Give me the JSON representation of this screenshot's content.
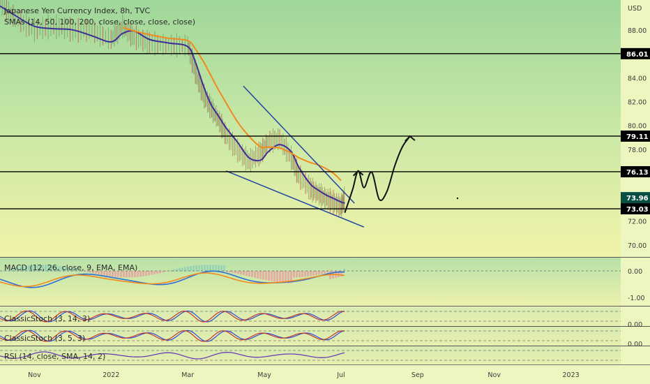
{
  "chart_data": {
    "type": "line",
    "title": "Japanese Yen Currency Index, 8h, TVC",
    "indicator_label": "SMAs (14, 50, 100, 200, close, close, close, close)",
    "currency": "USD",
    "y_ticks": [
      "88.00",
      "86.00",
      "84.00",
      "82.00",
      "80.00",
      "78.00",
      "76.00",
      "74.00",
      "72.00",
      "70.00"
    ],
    "ylim": [
      69,
      90.5
    ],
    "x_ticks": [
      "Nov",
      "2022",
      "Mar",
      "May",
      "Jul",
      "Sep",
      "Nov",
      "2023"
    ],
    "x_tick_months": [
      10,
      12,
      14,
      16,
      18,
      20,
      22,
      24
    ],
    "xlim": [
      9.1,
      25.3
    ],
    "levels": [
      {
        "value": 86.01,
        "label": "86.01",
        "color": "#000000"
      },
      {
        "value": 79.11,
        "label": "79.11",
        "color": "#000000"
      },
      {
        "value": 76.13,
        "label": "76.13",
        "color": "#000000"
      },
      {
        "value": 73.03,
        "label": "73.03",
        "color": "#000000"
      }
    ],
    "last_price": {
      "value": 73.96,
      "label": "73.96",
      "color": "#0b4f43"
    },
    "price": {
      "x": [
        9.1,
        9.5,
        10.0,
        10.5,
        11.0,
        11.5,
        12.0,
        12.3,
        12.6,
        13.0,
        13.5,
        14.0,
        14.2,
        14.4,
        14.6,
        14.8,
        15.0,
        15.3,
        15.6,
        15.9,
        16.1,
        16.4,
        16.7,
        16.9,
        17.2,
        17.4,
        17.6,
        17.8,
        18.0,
        18.1
      ],
      "y": [
        90.3,
        89.0,
        88.0,
        88.3,
        88.0,
        87.9,
        87.2,
        88.3,
        87.4,
        86.9,
        86.7,
        86.7,
        84.5,
        82.6,
        81.5,
        80.5,
        79.2,
        77.9,
        77.0,
        77.7,
        78.6,
        78.9,
        77.3,
        75.8,
        74.7,
        74.3,
        73.9,
        73.6,
        73.2,
        74.0
      ]
    },
    "series": [
      {
        "name": "SMA 14",
        "color": "#3c2d9a",
        "x": [
          9.1,
          9.5,
          10.0,
          10.5,
          11.0,
          11.5,
          12.0,
          12.3,
          12.6,
          13.0,
          13.5,
          14.0,
          14.2,
          14.4,
          14.6,
          14.8,
          15.0,
          15.3,
          15.6,
          15.9,
          16.1,
          16.4,
          16.7,
          16.9,
          17.2,
          17.4,
          17.6,
          17.8,
          18.0,
          18.1
        ],
        "y": [
          90.0,
          89.2,
          88.3,
          88.1,
          88.0,
          87.5,
          87.0,
          87.7,
          87.9,
          87.2,
          86.9,
          86.6,
          85.3,
          83.4,
          81.8,
          80.8,
          79.8,
          78.6,
          77.3,
          77.1,
          77.8,
          78.4,
          77.8,
          76.5,
          75.1,
          74.6,
          74.2,
          73.9,
          73.6,
          73.5
        ]
      },
      {
        "name": "SMA 50",
        "color": "#f08a1c",
        "x": [
          12.3,
          12.6,
          13.0,
          13.5,
          14.0,
          14.2,
          14.4,
          14.6,
          14.8,
          15.0,
          15.3,
          15.6,
          15.9,
          16.1,
          16.4,
          16.7,
          16.9,
          17.2,
          17.4,
          17.6,
          17.8,
          18.0
        ],
        "y": [
          88.2,
          87.9,
          87.6,
          87.3,
          87.1,
          86.4,
          85.4,
          84.2,
          83.0,
          81.9,
          80.3,
          79.1,
          78.2,
          78.2,
          78.1,
          77.7,
          77.3,
          76.9,
          76.7,
          76.4,
          76.0,
          75.4
        ]
      }
    ],
    "annotations": {
      "wedge_upper": {
        "x": [
          15.45,
          18.35
        ],
        "y": [
          83.3,
          73.5
        ]
      },
      "wedge_lower": {
        "x": [
          15.0,
          18.6
        ],
        "y": [
          76.2,
          71.5
        ]
      },
      "projection": {
        "x": [
          18.1,
          18.3,
          18.45,
          18.6,
          18.8,
          19.0,
          19.2,
          19.4,
          19.6,
          19.8
        ],
        "y": [
          72.7,
          74.6,
          76.2,
          74.8,
          76.1,
          73.8,
          74.5,
          76.6,
          78.2,
          79.1
        ]
      }
    },
    "macd": {
      "label": "MACD (12, 26, close, 9, EMA, EMA)",
      "ticks": [
        "0.00",
        "-1.00"
      ]
    },
    "stoch1": {
      "label": "ClassicStoch (3, 14, 3)",
      "ticks": [
        "0.00"
      ]
    },
    "stoch2": {
      "label": "ClassicStoch (3, 5, 3)",
      "ticks": [
        "0.00"
      ]
    },
    "rsi": {
      "label": "RSI (14, close, SMA, 14, 2)"
    }
  }
}
